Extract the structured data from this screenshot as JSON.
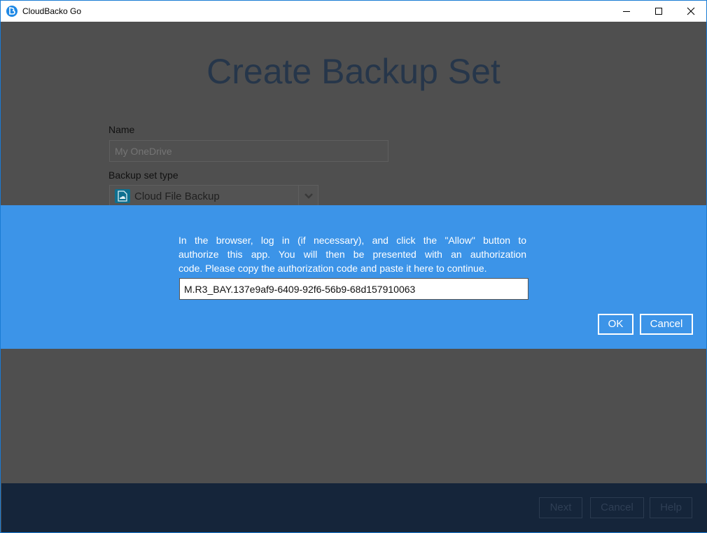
{
  "window": {
    "title": "CloudBacko Go",
    "app_icon": "cloudbacko-logo-icon",
    "controls": [
      "minimize-icon",
      "maximize-icon",
      "close-icon"
    ]
  },
  "page": {
    "title": "Create Backup Set",
    "name_label": "Name",
    "name_placeholder": "My OneDrive",
    "type_label": "Backup set type",
    "type_value": "Cloud File Backup",
    "type_icon": "cloud-file-icon"
  },
  "footer": {
    "next_label": "Next",
    "cancel_label": "Cancel",
    "help_label": "Help"
  },
  "dialog": {
    "message_lines": [
      "In the browser, log in (if necessary), and click the \"Allow\" button to",
      "authorize this app. You will then be presented with an authorization",
      "code. Please copy the authorization code and paste it here to continue."
    ],
    "code_value": "M.R3_BAY.137e9af9-6409-92f6-56b9-68d157910063",
    "ok_label": "OK",
    "cancel_label": "Cancel"
  },
  "colors": {
    "dialog_bg": "#3c94e8",
    "overlay_bg": "#4f4f4f",
    "footer_bg": "#15253a",
    "title_text": "#26364a"
  }
}
